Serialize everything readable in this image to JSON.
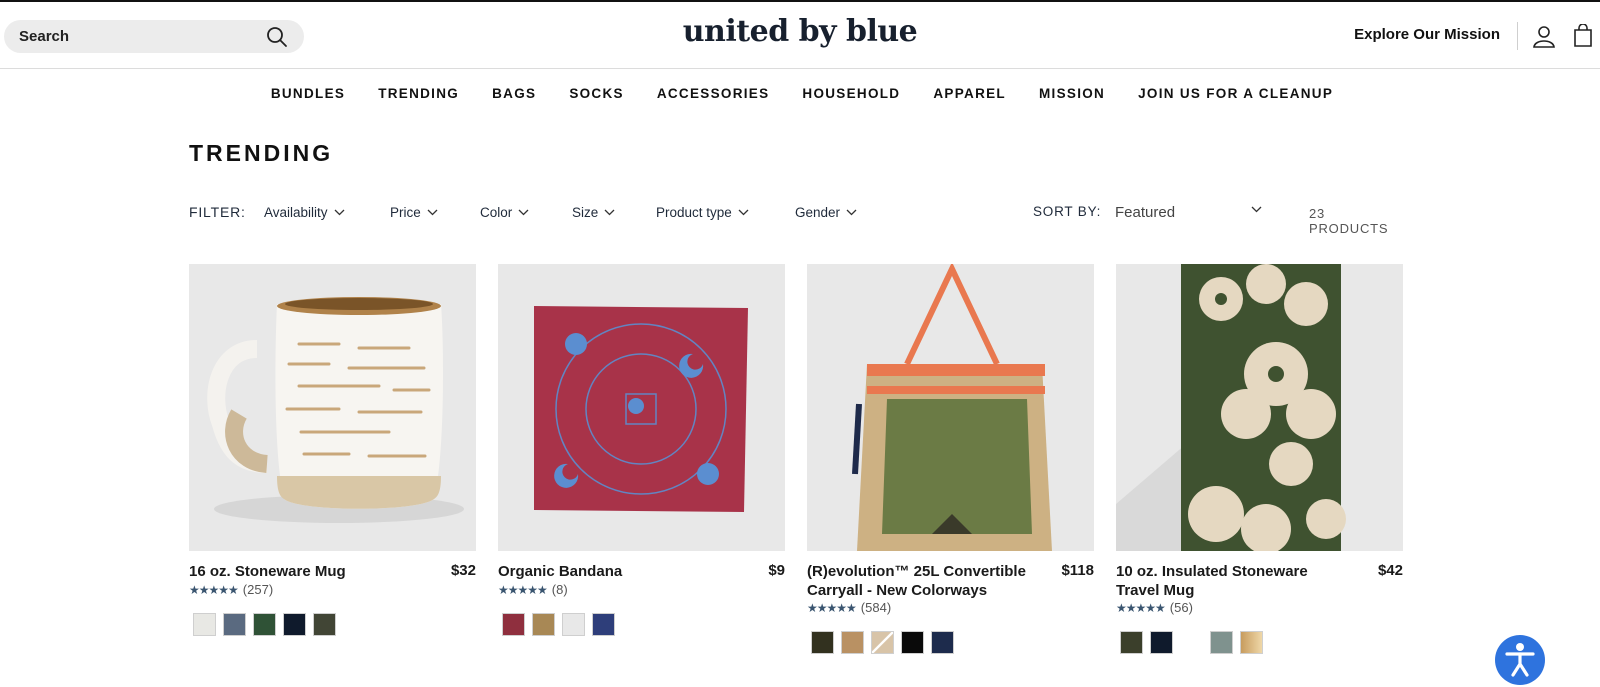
{
  "header": {
    "search_placeholder": "Search",
    "logo": "united by blue",
    "mission_link": "Explore Our Mission"
  },
  "nav": [
    "BUNDLES",
    "TRENDING",
    "BAGS",
    "SOCKS",
    "ACCESSORIES",
    "HOUSEHOLD",
    "APPAREL",
    "MISSION",
    "JOIN US FOR A CLEANUP"
  ],
  "page_title": "TRENDING",
  "filters": {
    "label": "FILTER:",
    "items": [
      "Availability",
      "Price",
      "Color",
      "Size",
      "Product type",
      "Gender"
    ],
    "sort_label": "SORT BY:",
    "sort_value": "Featured",
    "count": "23 PRODUCTS"
  },
  "products": [
    {
      "name": "16 oz. Stoneware Mug",
      "price": "$32",
      "stars": "★★★★★",
      "reviews": "(257)",
      "swatches": [
        "#e8e8e4",
        "#5a6a80",
        "#2f5236",
        "#0f1a2c",
        "#414535"
      ]
    },
    {
      "name": "Organic Bandana",
      "price": "$9",
      "stars": "★★★★★",
      "reviews": "(8)",
      "swatches": [
        "#8f2f3e",
        "#a88855",
        "#e8e8e8",
        "#2e3e7a"
      ]
    },
    {
      "name": "(R)evolution™ 25L Convertible Carryall - New Colorways",
      "price": "$118",
      "stars": "★★★★★",
      "reviews": "(584)",
      "swatches": [
        "#32311f",
        "#b99163",
        "#d8c4a8",
        "#0a0a0a",
        "#1d2b4c"
      ]
    },
    {
      "name": "10 oz. Insulated Stoneware Travel Mug",
      "price": "$42",
      "stars": "★★★★★",
      "reviews": "(56)",
      "swatches": [
        "#3b3f2b",
        "#0f1a2c",
        "#ffffff",
        "#7f928e",
        "#d5b27e"
      ]
    }
  ],
  "colors": {
    "accent_blue": "#2e73de",
    "star_color": "#3a5570",
    "logo_color": "#17202e"
  },
  "icons": [
    "search-icon",
    "user-icon",
    "cart-icon",
    "chevron-down-icon",
    "accessibility-icon"
  ]
}
